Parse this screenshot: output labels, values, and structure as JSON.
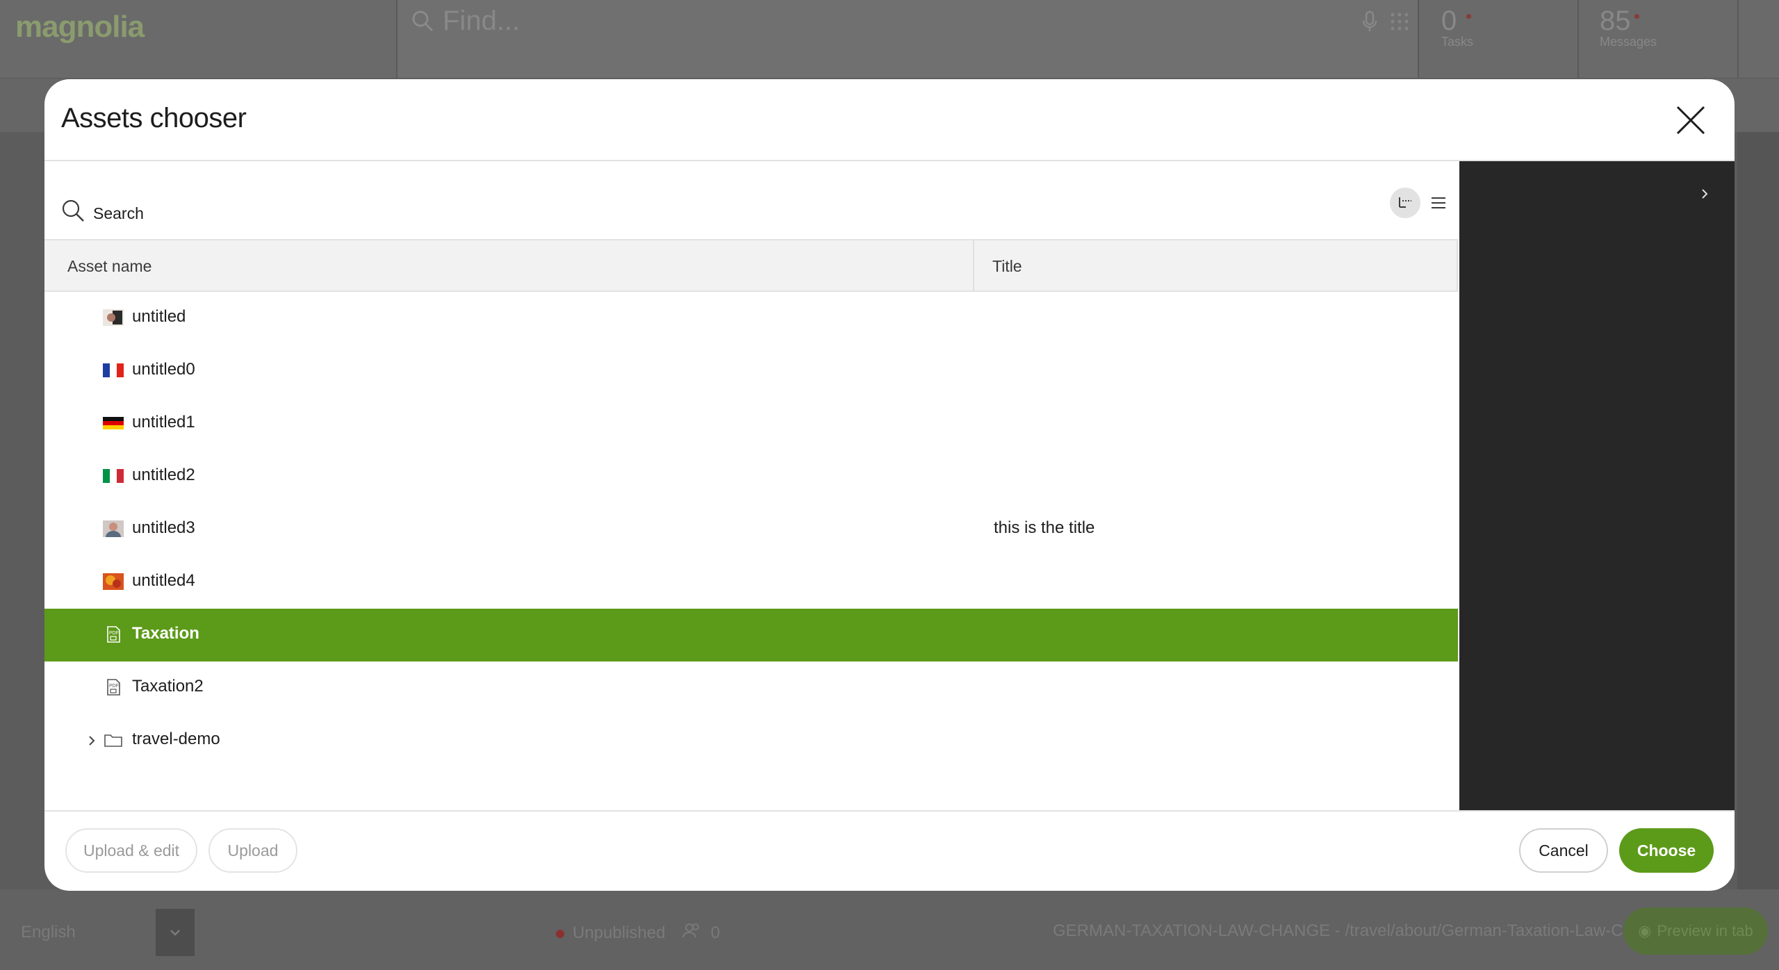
{
  "background": {
    "logo": "magnolia",
    "search_placeholder": "Find...",
    "tasks": {
      "count": "0",
      "label": "Tasks"
    },
    "messages": {
      "count": "85",
      "label": "Messages"
    },
    "footer": {
      "language": "English",
      "status": "Unpublished",
      "viewers": "0",
      "path": "GERMAN-TAXATION-LAW-CHANGE - /travel/about/German-Taxation-Law-Change",
      "preview_label": "Preview in tab"
    }
  },
  "modal": {
    "title": "Assets chooser",
    "search_label": "Search",
    "view_modes": [
      "tree",
      "list",
      "grid"
    ],
    "active_view": "tree",
    "columns": {
      "name": "Asset name",
      "title": "Title"
    },
    "rows": [
      {
        "name": "untitled",
        "title": "",
        "thumb": "photo-portrait"
      },
      {
        "name": "untitled0",
        "title": "",
        "thumb": "flag-france"
      },
      {
        "name": "untitled1",
        "title": "",
        "thumb": "flag-germany"
      },
      {
        "name": "untitled2",
        "title": "",
        "thumb": "flag-italy"
      },
      {
        "name": "untitled3",
        "title": "this is the title",
        "thumb": "photo-person"
      },
      {
        "name": "untitled4",
        "title": "",
        "thumb": "photo-colorful"
      },
      {
        "name": "Taxation",
        "title": "",
        "thumb": "pdf-icon"
      },
      {
        "name": "Taxation2",
        "title": "",
        "thumb": "pdf-icon"
      },
      {
        "name": "travel-demo",
        "title": "",
        "thumb": "folder-icon"
      }
    ],
    "selected_row": "Taxation",
    "buttons": {
      "upload_edit": "Upload & edit",
      "upload": "Upload",
      "cancel": "Cancel",
      "choose": "Choose"
    }
  },
  "colors": {
    "accent": "#5c9a19",
    "side_panel": "#272727"
  }
}
